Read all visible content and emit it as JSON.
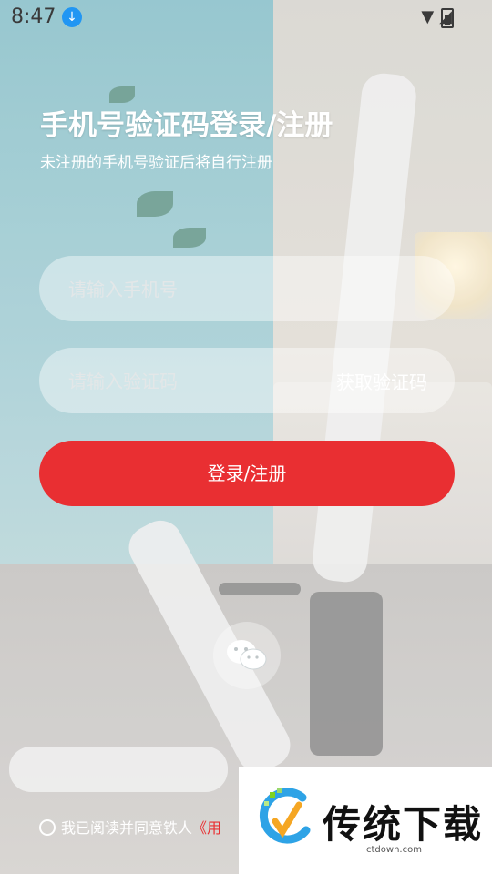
{
  "status_bar": {
    "time": "8:47",
    "download_icon": "download-badge-icon",
    "icons": [
      "wifi-icon",
      "signal-icon",
      "battery-charging-icon"
    ]
  },
  "header": {
    "title": "手机号验证码登录/注册",
    "subtitle": "未注册的手机号验证后将自行注册"
  },
  "form": {
    "phone_placeholder": "请输入手机号",
    "phone_value": "",
    "code_placeholder": "请输入验证码",
    "code_value": "",
    "get_code_label": "获取验证码",
    "submit_label": "登录/注册"
  },
  "social": {
    "wechat_icon": "wechat-icon"
  },
  "agreement": {
    "text": "我已阅读并同意铁人",
    "link_text": "《用"
  },
  "watermark": {
    "brand": "传统下载",
    "url": "ctdown.com"
  },
  "colors": {
    "primary": "#e92f32",
    "status_accent": "#2196f3"
  }
}
